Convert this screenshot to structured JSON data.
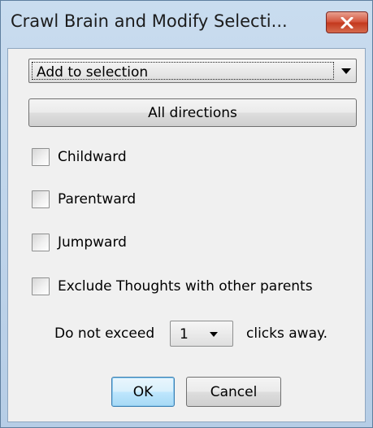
{
  "window": {
    "title": "Crawl Brain and Modify Selecti...",
    "close_icon": "close-icon"
  },
  "mode_select": {
    "selected": "Add to selection"
  },
  "direction_button": {
    "label": "All directions"
  },
  "checkboxes": [
    {
      "label": "Childward",
      "checked": false
    },
    {
      "label": "Parentward",
      "checked": false
    },
    {
      "label": "Jumpward",
      "checked": false
    },
    {
      "label": "Exclude Thoughts with other parents",
      "checked": false
    }
  ],
  "limit": {
    "prefix": "Do not exceed",
    "selected": "1",
    "suffix": "clicks away."
  },
  "buttons": {
    "ok": "OK",
    "cancel": "Cancel"
  },
  "colors": {
    "window_frame": "#c9dcef",
    "client_bg": "#f0f0f0",
    "close_button": "#c3381d",
    "default_button": "#bee6fd"
  }
}
